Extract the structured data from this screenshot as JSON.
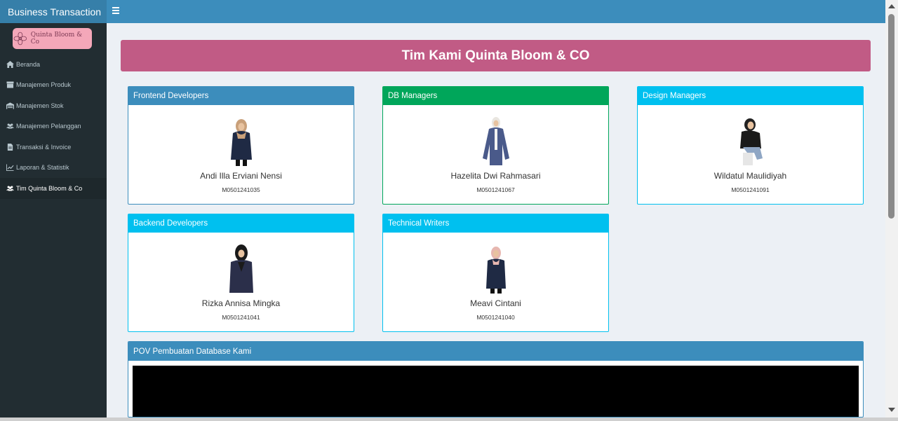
{
  "app": {
    "title": "Business Transaction"
  },
  "brand": {
    "logo_text": "Quinta Bloom & Co"
  },
  "sidebar": {
    "items": [
      {
        "label": "Beranda",
        "icon": "home-icon"
      },
      {
        "label": "Manajemen Produk",
        "icon": "archive-icon"
      },
      {
        "label": "Manajemen Stok",
        "icon": "warehouse-icon"
      },
      {
        "label": "Manajemen Pelanggan",
        "icon": "users-icon"
      },
      {
        "label": "Transaksi & Invoice",
        "icon": "file-icon"
      },
      {
        "label": "Laporan & Statistik",
        "icon": "line-chart-icon"
      },
      {
        "label": "Tim Quinta Bloom & Co",
        "icon": "users-icon",
        "active": true
      }
    ]
  },
  "page": {
    "title": "Tim Kami Quinta Bloom & CO"
  },
  "team": [
    {
      "role": "Frontend Developers",
      "name": "Andi Illa Erviani Nensi",
      "id": "M0501241035",
      "color": "#3c8dbc"
    },
    {
      "role": "DB Managers",
      "name": "Hazelita Dwi Rahmasari",
      "id": "M0501241067",
      "color": "#00a65a"
    },
    {
      "role": "Design Managers",
      "name": "Wildatul Maulidiyah",
      "id": "M0501241091",
      "color": "#00c0ef"
    },
    {
      "role": "Backend Developers",
      "name": "Rizka Annisa Mingka",
      "id": "M0501241041",
      "color": "#00c0ef"
    },
    {
      "role": "Technical Writers",
      "name": "Meavi Cintani",
      "id": "M0501241040",
      "color": "#00c0ef"
    }
  ],
  "pov": {
    "title": "POV Pembuatan Database Kami"
  },
  "colors": {
    "header": "#3c8dbc",
    "sidebar": "#222d32",
    "banner": "#c15b85",
    "background": "#ecf0f5"
  }
}
